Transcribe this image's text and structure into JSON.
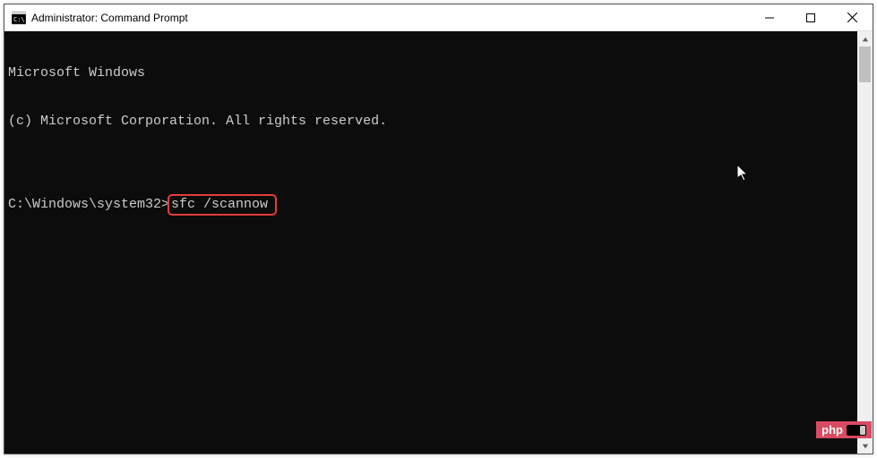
{
  "window": {
    "title": "Administrator: Command Prompt",
    "controls": {
      "minimize": "minimize",
      "maximize": "maximize",
      "close": "close"
    }
  },
  "console": {
    "line1": "Microsoft Windows",
    "line2": "(c) Microsoft Corporation. All rights reserved.",
    "blank": "",
    "prompt": "C:\\Windows\\system32>",
    "command": "sfc /scannow"
  },
  "watermark": {
    "text": "php"
  }
}
